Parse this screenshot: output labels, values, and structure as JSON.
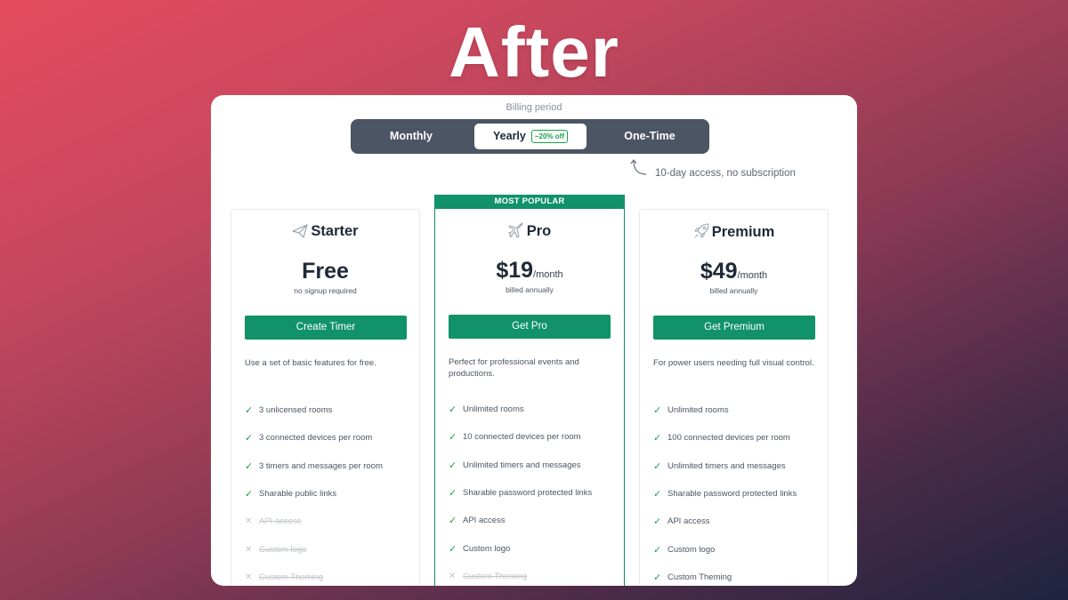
{
  "headline": "After",
  "billing": {
    "label": "Billing period",
    "options": [
      "Monthly",
      "Yearly",
      "One-Time"
    ],
    "selected": "Yearly",
    "discount_badge": "~20% off",
    "hint": "10-day access, no subscription"
  },
  "colors": {
    "accent": "#119268",
    "check": "#16a34a",
    "toggle_bg": "#4b5563"
  },
  "plans": [
    {
      "name": "Starter",
      "icon": "paper-plane-icon",
      "price": "Free",
      "per": "",
      "note": "no signup required",
      "cta": "Create Timer",
      "description": "Use a set of basic features for free.",
      "features": [
        {
          "text": "3 unlicensed rooms",
          "included": true
        },
        {
          "text": "3 connected devices per room",
          "included": true
        },
        {
          "text": "3 timers and messages per room",
          "included": true
        },
        {
          "text": "Sharable public links",
          "included": true
        },
        {
          "text": "API access",
          "included": false
        },
        {
          "text": "Custom logo",
          "included": false
        },
        {
          "text": "Custom Theming",
          "included": false
        }
      ]
    },
    {
      "name": "Pro",
      "icon": "airplane-icon",
      "badge": "MOST POPULAR",
      "price": "$19",
      "per": "/month",
      "note": "billed annually",
      "cta": "Get Pro",
      "description": "Perfect for professional events and productions.",
      "features": [
        {
          "text": "Unlimited rooms",
          "included": true
        },
        {
          "text": "10 connected devices per room",
          "included": true
        },
        {
          "text": "Unlimited timers and messages",
          "included": true
        },
        {
          "text": "Sharable password protected links",
          "included": true
        },
        {
          "text": "API access",
          "included": true
        },
        {
          "text": "Custom logo",
          "included": true
        },
        {
          "text": "Custom Theming",
          "included": false
        }
      ]
    },
    {
      "name": "Premium",
      "icon": "rocket-icon",
      "price": "$49",
      "per": "/month",
      "note": "billed annually",
      "cta": "Get Premium",
      "description": "For power users needing full visual control.",
      "features": [
        {
          "text": "Unlimited rooms",
          "included": true
        },
        {
          "text": "100 connected devices per room",
          "included": true
        },
        {
          "text": "Unlimited timers and messages",
          "included": true
        },
        {
          "text": "Sharable password protected links",
          "included": true
        },
        {
          "text": "API access",
          "included": true
        },
        {
          "text": "Custom logo",
          "included": true
        },
        {
          "text": "Custom Theming",
          "included": true
        }
      ]
    }
  ]
}
